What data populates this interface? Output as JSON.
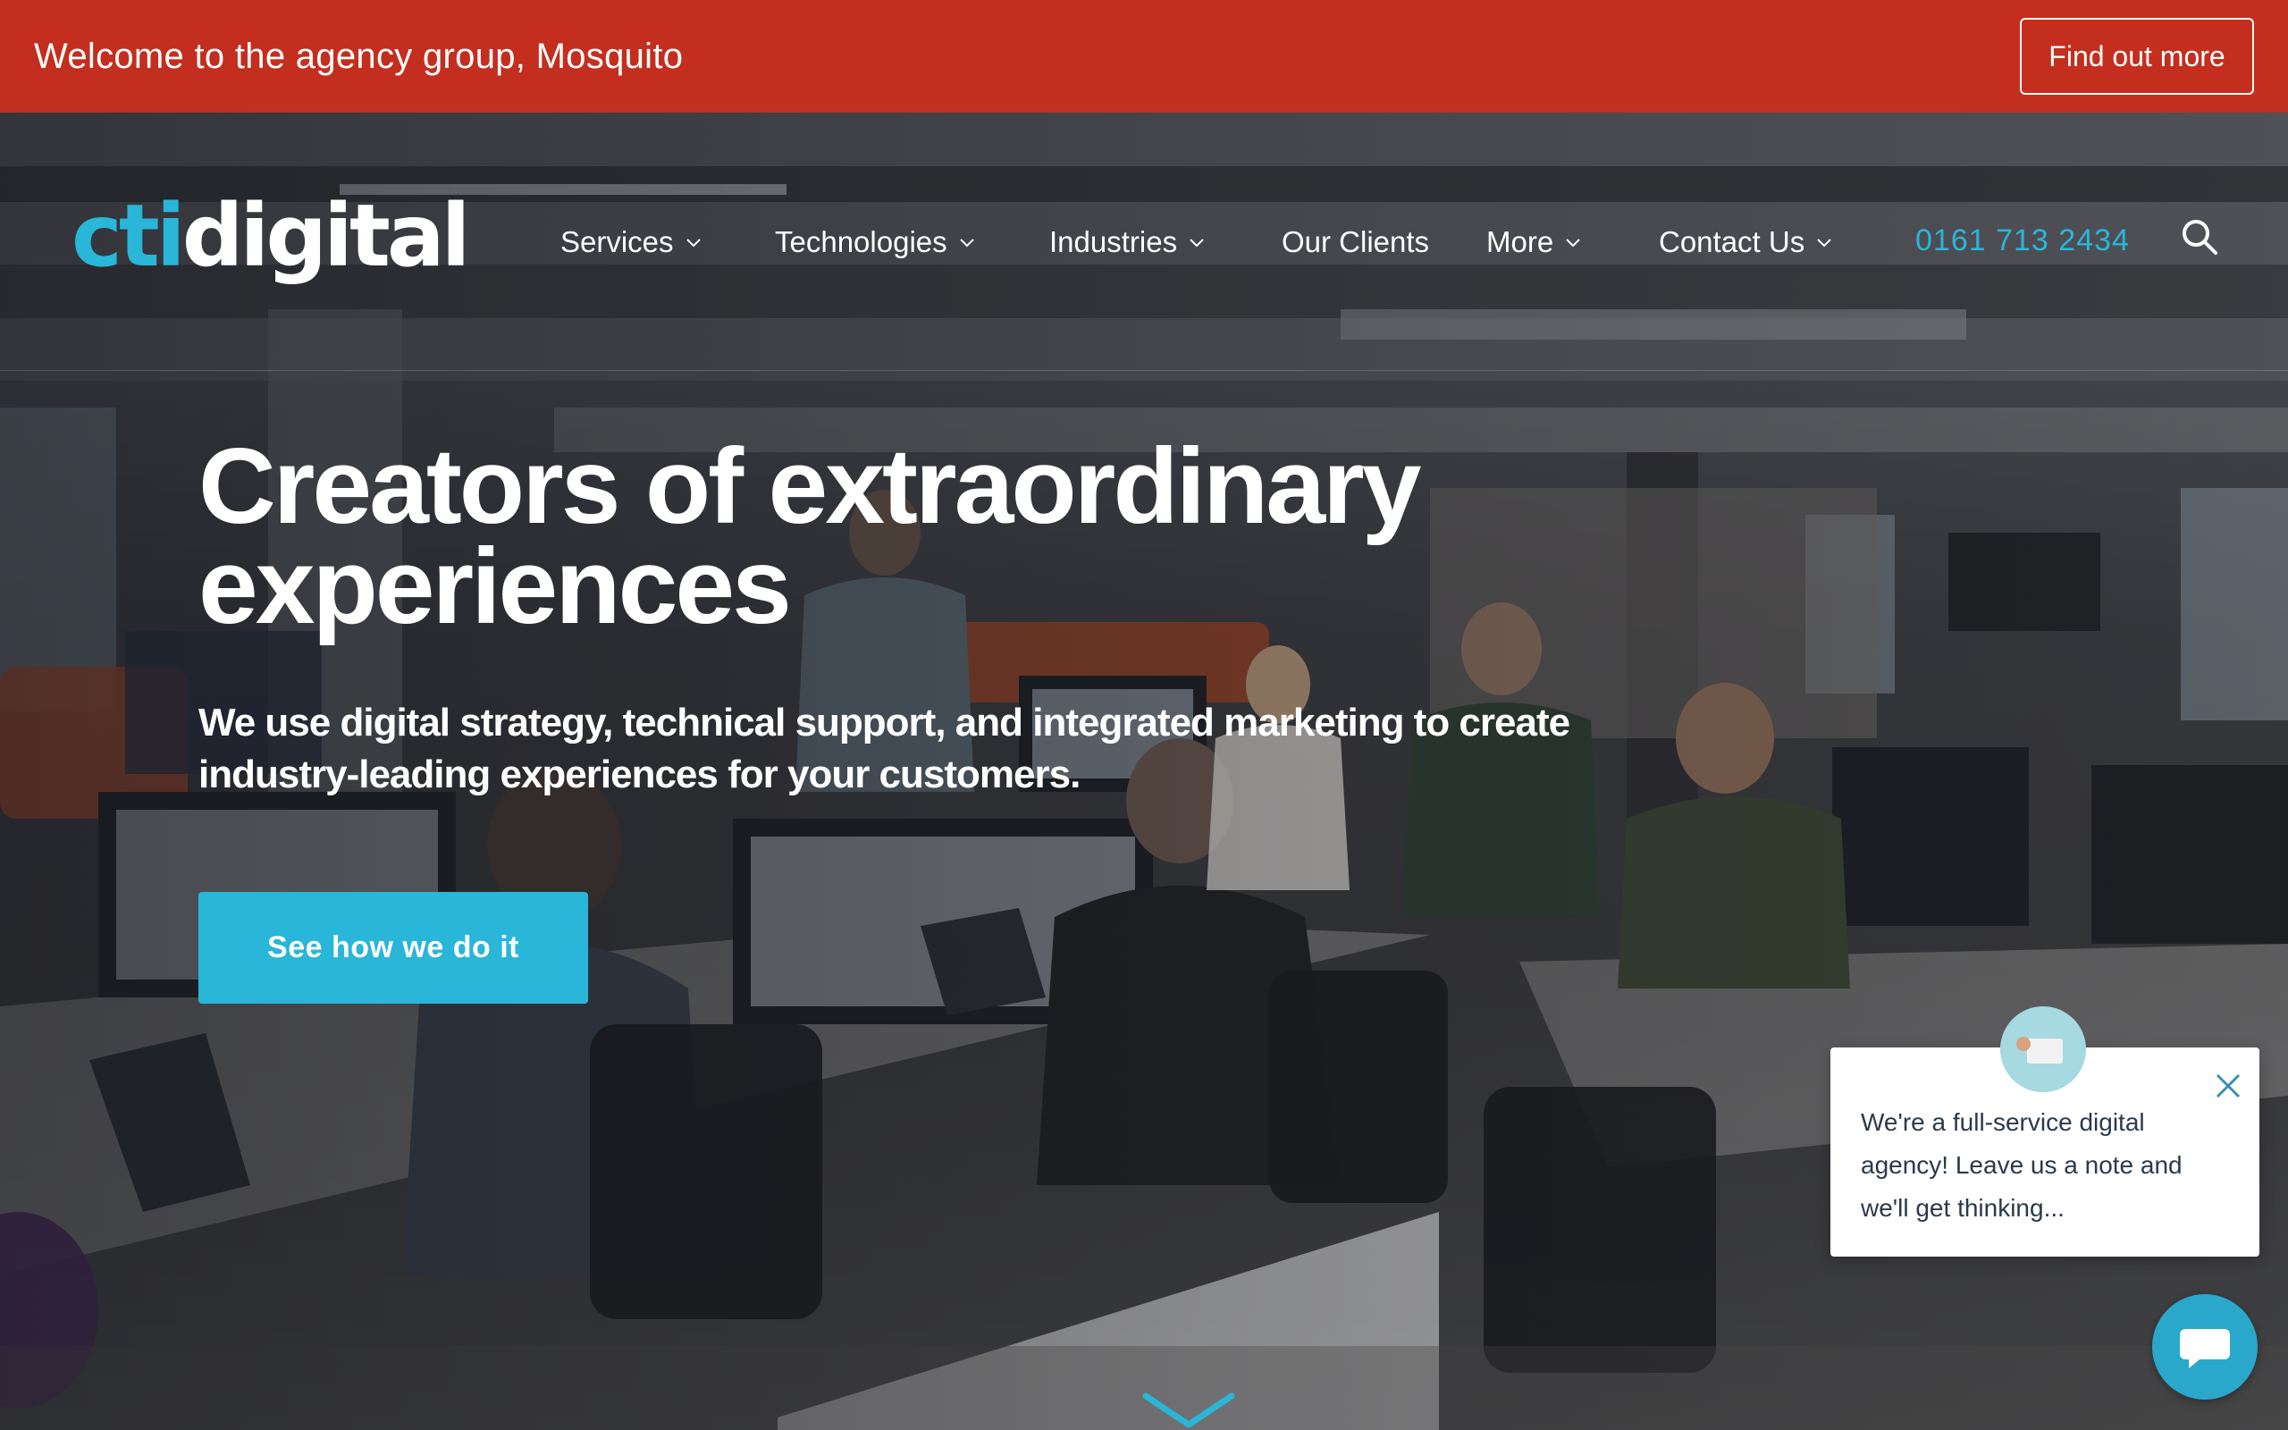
{
  "banner": {
    "text": "Welcome to the agency group, Mosquito",
    "button_label": "Find out more"
  },
  "nav": {
    "logo_part1": "cti",
    "logo_part2": "digital",
    "items": [
      {
        "label": "Services",
        "has_dropdown": true
      },
      {
        "label": "Technologies",
        "has_dropdown": true
      },
      {
        "label": "Industries",
        "has_dropdown": true
      },
      {
        "label": "Our Clients",
        "has_dropdown": false
      },
      {
        "label": "More",
        "has_dropdown": true
      },
      {
        "label": "Contact Us",
        "has_dropdown": true
      }
    ],
    "phone": "0161 713 2434",
    "search_icon": "search-icon"
  },
  "hero": {
    "title_line1": "Creators of extraordinary",
    "title_line2": "experiences",
    "subtitle_line1": "We use digital strategy, technical support, and integrated marketing to create",
    "subtitle_line2": "industry-leading experiences for your customers.",
    "cta_label": "See how we do it",
    "scroll_icon": "chevron-down-icon"
  },
  "chat": {
    "message": "We're a full-service digital agency! Leave us a note and we'll get thinking...",
    "close_icon": "close-icon",
    "launcher_icon": "chat-icon"
  },
  "colors": {
    "banner": "#c42e1f",
    "accent": "#29b6d8",
    "text_light": "#ffffff",
    "chat_text": "#2b3a4a"
  }
}
